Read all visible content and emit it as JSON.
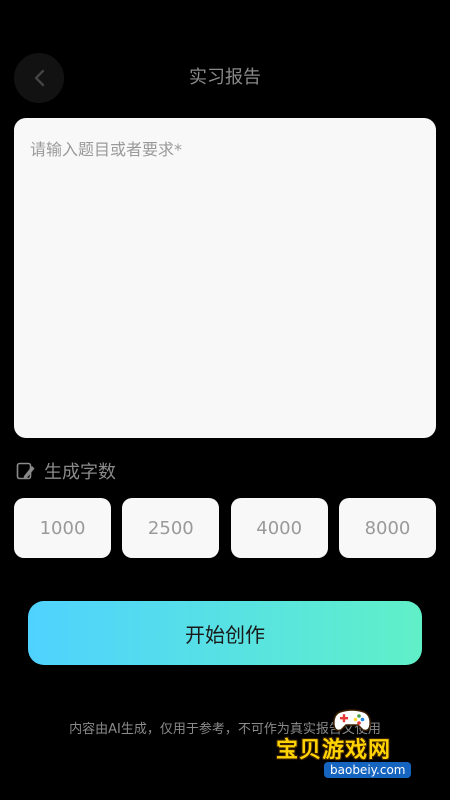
{
  "header": {
    "title": "实习报告",
    "back_icon": "chevron-left-icon"
  },
  "topic": {
    "placeholder": "请输入题目或者要求*",
    "value": ""
  },
  "word_count": {
    "label": "生成字数",
    "icon": "edit-document-icon",
    "options": [
      "1000",
      "2500",
      "4000",
      "8000"
    ]
  },
  "actions": {
    "start_label": "开始创作"
  },
  "footer": {
    "disclaimer": "内容由AI生成，仅用于参考，不可作为真实报告文使用"
  },
  "watermark": {
    "name": "宝贝游戏网",
    "url": "baobeiy.com"
  },
  "colors": {
    "background": "#000000",
    "card": "#f8f8f8",
    "text_muted": "#8a8a8a",
    "button_gradient_start": "#4fd2ff",
    "button_gradient_end": "#60f0c8",
    "watermark_yellow": "#ffd400"
  }
}
